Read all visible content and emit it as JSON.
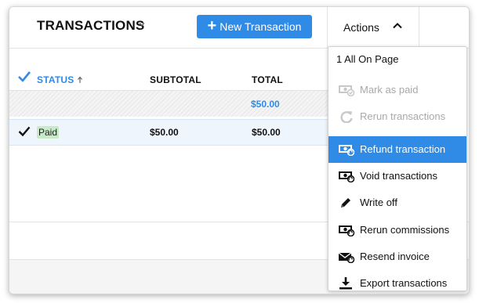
{
  "header": {
    "title": "TRANSACTIONS",
    "new_button_label": "New Transaction",
    "new_button_plus": "+",
    "actions_label": "Actions"
  },
  "table": {
    "columns": {
      "status": "STATUS",
      "subtotal": "SUBTOTAL",
      "total": "TOTAL"
    },
    "summary_total": "$50.00",
    "rows": [
      {
        "status": "Paid",
        "subtotal": "$50.00",
        "total": "$50.00"
      }
    ]
  },
  "actions_menu": {
    "header": "1 All On Page",
    "items": [
      {
        "label": "Mark as paid",
        "icon": "cash-check-icon"
      },
      {
        "label": "Rerun transactions",
        "icon": "refresh-icon"
      },
      {
        "label": "Refund transaction",
        "icon": "cash-refund-icon"
      },
      {
        "label": "Void transactions",
        "icon": "cash-void-icon"
      },
      {
        "label": "Write off",
        "icon": "pencil-icon"
      },
      {
        "label": "Rerun commissions",
        "icon": "cash-refresh-icon"
      },
      {
        "label": "Resend invoice",
        "icon": "envelope-refresh-icon"
      },
      {
        "label": "Export transactions",
        "icon": "download-icon"
      }
    ]
  },
  "colors": {
    "accent": "#2f8be6",
    "paid_badge": "#c9eac9",
    "disabled_text": "#a9a9a9"
  }
}
